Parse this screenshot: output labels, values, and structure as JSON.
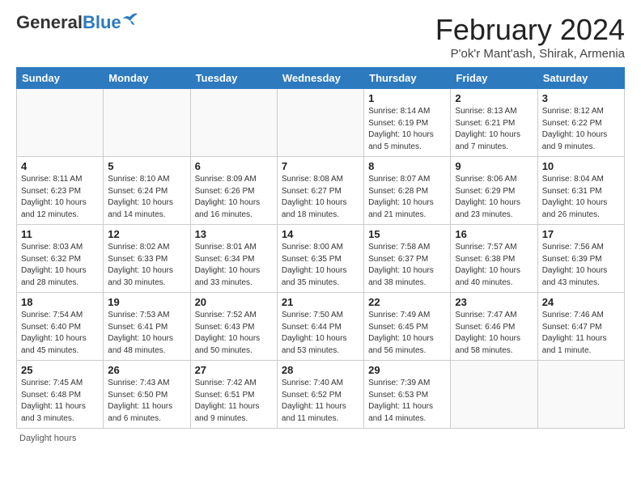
{
  "logo": {
    "line1": "General",
    "line2": "Blue"
  },
  "header": {
    "title": "February 2024",
    "subtitle": "P'ok'r Mant'ash, Shirak, Armenia"
  },
  "columns": [
    "Sunday",
    "Monday",
    "Tuesday",
    "Wednesday",
    "Thursday",
    "Friday",
    "Saturday"
  ],
  "weeks": [
    [
      {
        "day": "",
        "info": ""
      },
      {
        "day": "",
        "info": ""
      },
      {
        "day": "",
        "info": ""
      },
      {
        "day": "",
        "info": ""
      },
      {
        "day": "1",
        "info": "Sunrise: 8:14 AM\nSunset: 6:19 PM\nDaylight: 10 hours and 5 minutes."
      },
      {
        "day": "2",
        "info": "Sunrise: 8:13 AM\nSunset: 6:21 PM\nDaylight: 10 hours and 7 minutes."
      },
      {
        "day": "3",
        "info": "Sunrise: 8:12 AM\nSunset: 6:22 PM\nDaylight: 10 hours and 9 minutes."
      }
    ],
    [
      {
        "day": "4",
        "info": "Sunrise: 8:11 AM\nSunset: 6:23 PM\nDaylight: 10 hours and 12 minutes."
      },
      {
        "day": "5",
        "info": "Sunrise: 8:10 AM\nSunset: 6:24 PM\nDaylight: 10 hours and 14 minutes."
      },
      {
        "day": "6",
        "info": "Sunrise: 8:09 AM\nSunset: 6:26 PM\nDaylight: 10 hours and 16 minutes."
      },
      {
        "day": "7",
        "info": "Sunrise: 8:08 AM\nSunset: 6:27 PM\nDaylight: 10 hours and 18 minutes."
      },
      {
        "day": "8",
        "info": "Sunrise: 8:07 AM\nSunset: 6:28 PM\nDaylight: 10 hours and 21 minutes."
      },
      {
        "day": "9",
        "info": "Sunrise: 8:06 AM\nSunset: 6:29 PM\nDaylight: 10 hours and 23 minutes."
      },
      {
        "day": "10",
        "info": "Sunrise: 8:04 AM\nSunset: 6:31 PM\nDaylight: 10 hours and 26 minutes."
      }
    ],
    [
      {
        "day": "11",
        "info": "Sunrise: 8:03 AM\nSunset: 6:32 PM\nDaylight: 10 hours and 28 minutes."
      },
      {
        "day": "12",
        "info": "Sunrise: 8:02 AM\nSunset: 6:33 PM\nDaylight: 10 hours and 30 minutes."
      },
      {
        "day": "13",
        "info": "Sunrise: 8:01 AM\nSunset: 6:34 PM\nDaylight: 10 hours and 33 minutes."
      },
      {
        "day": "14",
        "info": "Sunrise: 8:00 AM\nSunset: 6:35 PM\nDaylight: 10 hours and 35 minutes."
      },
      {
        "day": "15",
        "info": "Sunrise: 7:58 AM\nSunset: 6:37 PM\nDaylight: 10 hours and 38 minutes."
      },
      {
        "day": "16",
        "info": "Sunrise: 7:57 AM\nSunset: 6:38 PM\nDaylight: 10 hours and 40 minutes."
      },
      {
        "day": "17",
        "info": "Sunrise: 7:56 AM\nSunset: 6:39 PM\nDaylight: 10 hours and 43 minutes."
      }
    ],
    [
      {
        "day": "18",
        "info": "Sunrise: 7:54 AM\nSunset: 6:40 PM\nDaylight: 10 hours and 45 minutes."
      },
      {
        "day": "19",
        "info": "Sunrise: 7:53 AM\nSunset: 6:41 PM\nDaylight: 10 hours and 48 minutes."
      },
      {
        "day": "20",
        "info": "Sunrise: 7:52 AM\nSunset: 6:43 PM\nDaylight: 10 hours and 50 minutes."
      },
      {
        "day": "21",
        "info": "Sunrise: 7:50 AM\nSunset: 6:44 PM\nDaylight: 10 hours and 53 minutes."
      },
      {
        "day": "22",
        "info": "Sunrise: 7:49 AM\nSunset: 6:45 PM\nDaylight: 10 hours and 56 minutes."
      },
      {
        "day": "23",
        "info": "Sunrise: 7:47 AM\nSunset: 6:46 PM\nDaylight: 10 hours and 58 minutes."
      },
      {
        "day": "24",
        "info": "Sunrise: 7:46 AM\nSunset: 6:47 PM\nDaylight: 11 hours and 1 minute."
      }
    ],
    [
      {
        "day": "25",
        "info": "Sunrise: 7:45 AM\nSunset: 6:48 PM\nDaylight: 11 hours and 3 minutes."
      },
      {
        "day": "26",
        "info": "Sunrise: 7:43 AM\nSunset: 6:50 PM\nDaylight: 11 hours and 6 minutes."
      },
      {
        "day": "27",
        "info": "Sunrise: 7:42 AM\nSunset: 6:51 PM\nDaylight: 11 hours and 9 minutes."
      },
      {
        "day": "28",
        "info": "Sunrise: 7:40 AM\nSunset: 6:52 PM\nDaylight: 11 hours and 11 minutes."
      },
      {
        "day": "29",
        "info": "Sunrise: 7:39 AM\nSunset: 6:53 PM\nDaylight: 11 hours and 14 minutes."
      },
      {
        "day": "",
        "info": ""
      },
      {
        "day": "",
        "info": ""
      }
    ]
  ],
  "footer": {
    "daylight_label": "Daylight hours"
  }
}
